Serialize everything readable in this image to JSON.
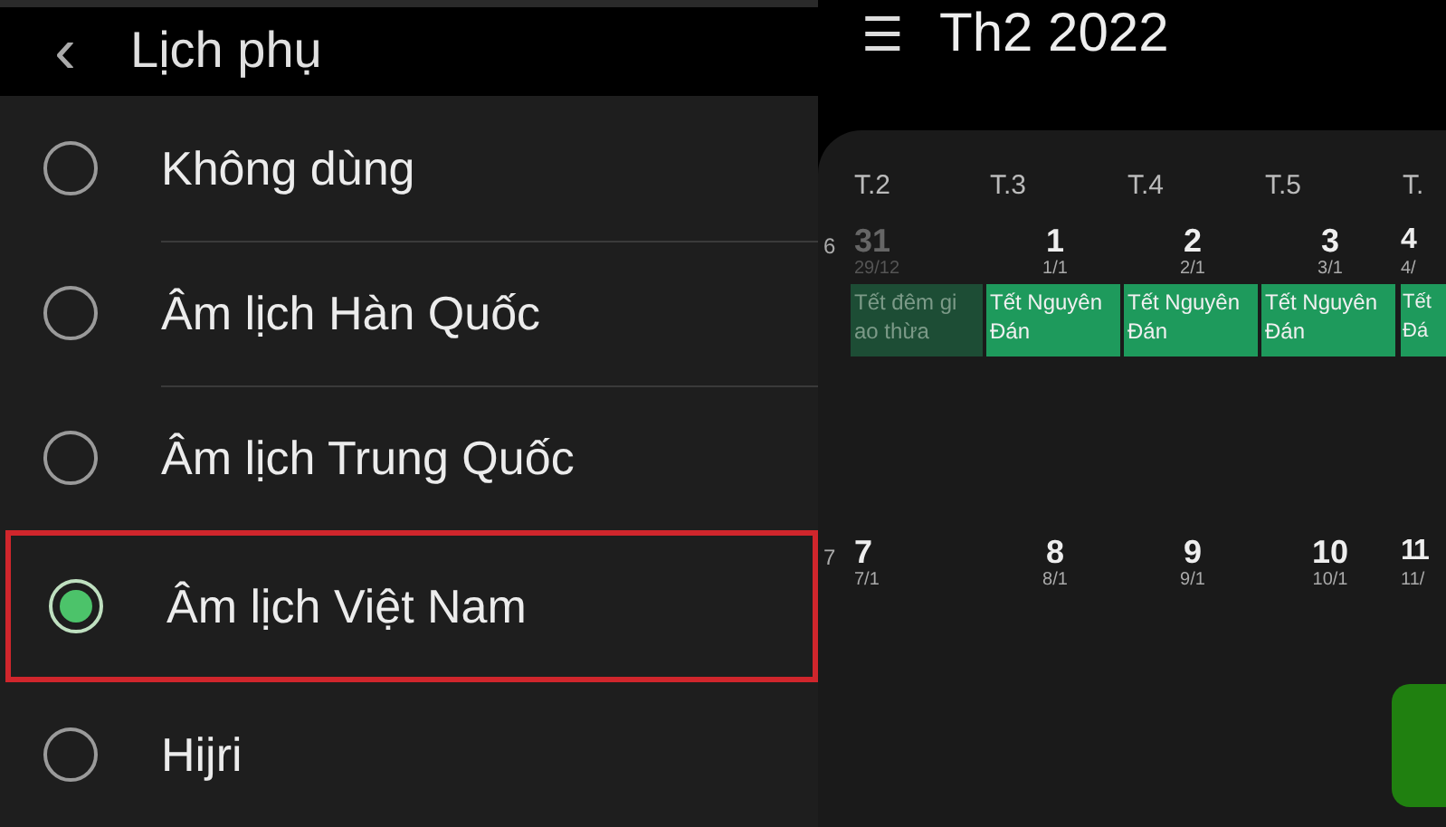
{
  "settings": {
    "back": "‹",
    "title": "Lịch phụ",
    "options": [
      {
        "label": "Không dùng",
        "selected": false
      },
      {
        "label": "Âm lịch Hàn Quốc",
        "selected": false
      },
      {
        "label": "Âm lịch Trung Quốc",
        "selected": false
      },
      {
        "label": "Âm lịch Việt Nam",
        "selected": true
      },
      {
        "label": "Hijri",
        "selected": false
      }
    ]
  },
  "calendar": {
    "menu": "☰",
    "title": "Th2 2022",
    "weekdays": [
      "T.2",
      "T.3",
      "T.4",
      "T.5",
      "T."
    ],
    "weeks": [
      {
        "number": "6",
        "days": [
          {
            "day": "31",
            "lunar": "29/12",
            "dimmed": true,
            "event": "Tết đêm gi ao thừa"
          },
          {
            "day": "1",
            "lunar": "1/1",
            "dimmed": false,
            "event": "Tết Nguyên Đán"
          },
          {
            "day": "2",
            "lunar": "2/1",
            "dimmed": false,
            "event": "Tết Nguyên Đán"
          },
          {
            "day": "3",
            "lunar": "3/1",
            "dimmed": false,
            "event": "Tết Nguyên Đán"
          },
          {
            "day": "4",
            "lunar": "4/",
            "dimmed": false,
            "event": "Tết Đá"
          }
        ]
      },
      {
        "number": "7",
        "days": [
          {
            "day": "7",
            "lunar": "7/1",
            "dimmed": false
          },
          {
            "day": "8",
            "lunar": "8/1",
            "dimmed": false
          },
          {
            "day": "9",
            "lunar": "9/1",
            "dimmed": false
          },
          {
            "day": "10",
            "lunar": "10/1",
            "dimmed": false
          },
          {
            "day": "11",
            "lunar": "11/",
            "dimmed": false
          }
        ]
      }
    ]
  }
}
